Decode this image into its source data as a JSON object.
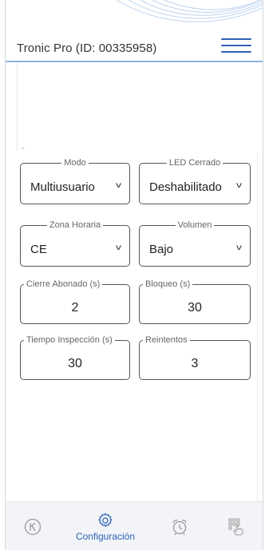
{
  "header": {
    "title": "Tronic Pro (ID: 00335958)",
    "accent_color": "#2a62b8"
  },
  "fields": {
    "modo": {
      "label": "Modo",
      "value": "Multiusuario",
      "type": "select"
    },
    "led_cerrado": {
      "label": "LED Cerrado",
      "value": "Deshabilitado",
      "type": "select"
    },
    "zona_horaria": {
      "label": "Zona Horaria",
      "value": "CE",
      "type": "select"
    },
    "volumen": {
      "label": "Volumen",
      "value": "Bajo",
      "type": "select"
    },
    "cierre_abonado": {
      "label": "Cierre Abonado (s)",
      "value": "2",
      "type": "number"
    },
    "bloqueo": {
      "label": "Bloqueo (s)",
      "value": "30",
      "type": "number"
    },
    "tiempo_inspeccion": {
      "label": "Tiempo Inspección (s)",
      "value": "30",
      "type": "number"
    },
    "reintentos": {
      "label": "Reintentos",
      "value": "3",
      "type": "number"
    }
  },
  "bottom_nav": {
    "items": [
      {
        "icon": "keypad-circle-icon"
      },
      {
        "icon": "gear-icon",
        "label": "Configuración",
        "active": true
      },
      {
        "icon": "alarm-clock-icon"
      },
      {
        "icon": "keypad-hand-icon"
      }
    ]
  }
}
